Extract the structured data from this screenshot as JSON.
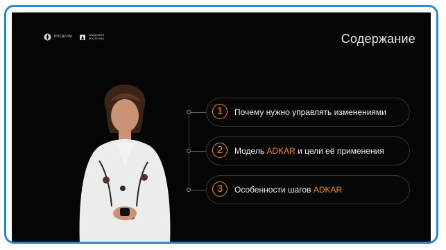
{
  "slide": {
    "title": "Содержание",
    "logo1": "РОСАТОМ",
    "logo2_line1": "АКАДЕМИЯ",
    "logo2_line2": "РОСАТОМА",
    "items": [
      {
        "number": "1",
        "text": "Почему нужно управлять изменениями",
        "accent": "",
        "text_after": ""
      },
      {
        "number": "2",
        "text": "Модель ",
        "accent": "ADKAR",
        "text_after": " и цели её применения"
      },
      {
        "number": "3",
        "text": "Особенности шагов ",
        "accent": "ADKAR",
        "text_after": ""
      }
    ]
  },
  "colors": {
    "frame_border": "#2f86c8",
    "accent": "#f28a29",
    "background": "#050505"
  }
}
